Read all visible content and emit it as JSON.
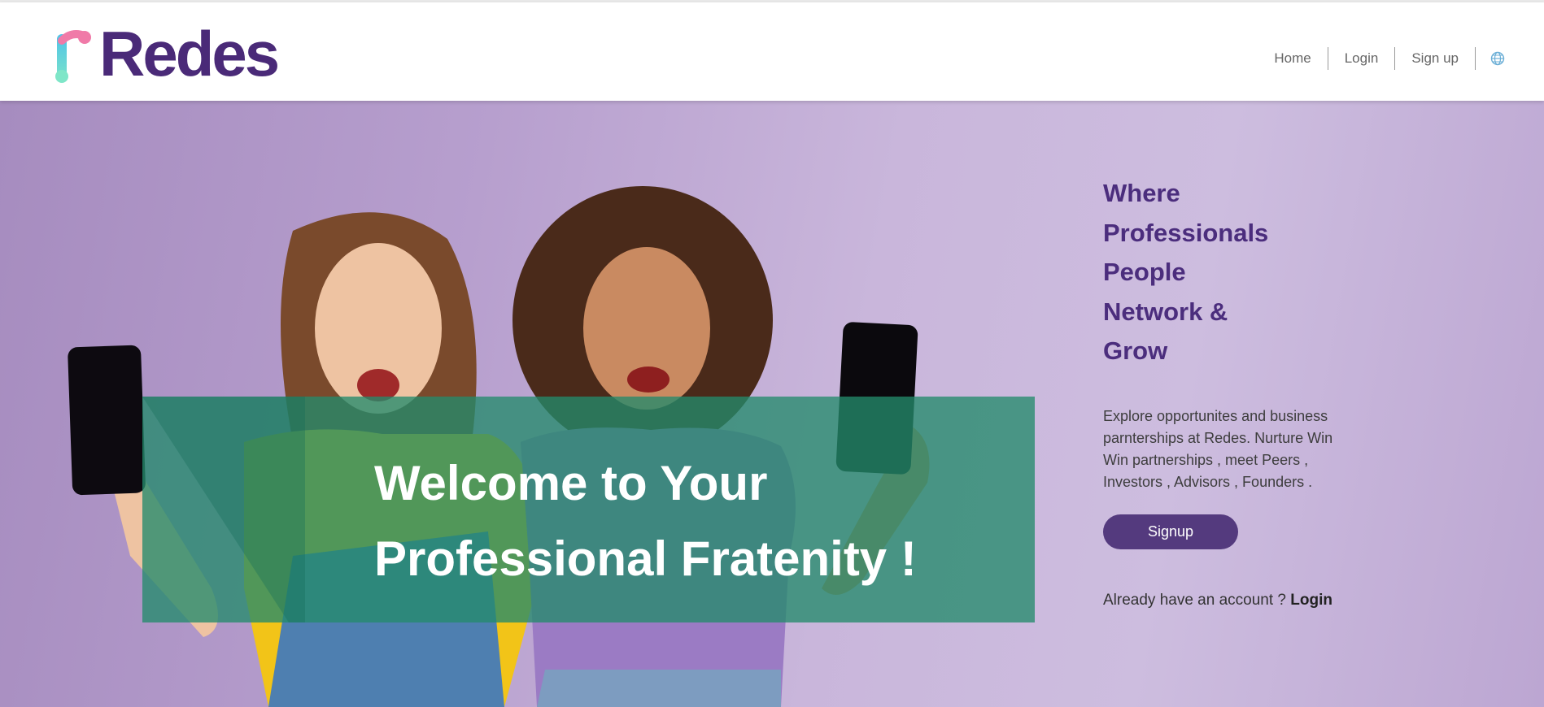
{
  "brand": {
    "name": "Redes",
    "color": "#4a2a78"
  },
  "nav": {
    "items": [
      {
        "label": "Home"
      },
      {
        "label": "Login"
      },
      {
        "label": "Sign up"
      }
    ],
    "language_icon": "globe-icon"
  },
  "hero": {
    "headline_line1": "Welcome to Your",
    "headline_line2": "Professional Fratenity !",
    "tagline": [
      "Where",
      "Professionals",
      "People",
      "Network &",
      "Grow"
    ],
    "description": "Explore opportunites and business parnterships at Redes. Nurture Win Win partnerships , meet Peers , Investors , Advisors , Founders .",
    "signup_label": "Signup",
    "already_text": "Already have an account ?",
    "login_link": "Login"
  },
  "colors": {
    "accent": "#543a7e",
    "tagline": "#4b2d7d",
    "banner": "#248a6c",
    "hero_bg": "#c9b6db"
  }
}
